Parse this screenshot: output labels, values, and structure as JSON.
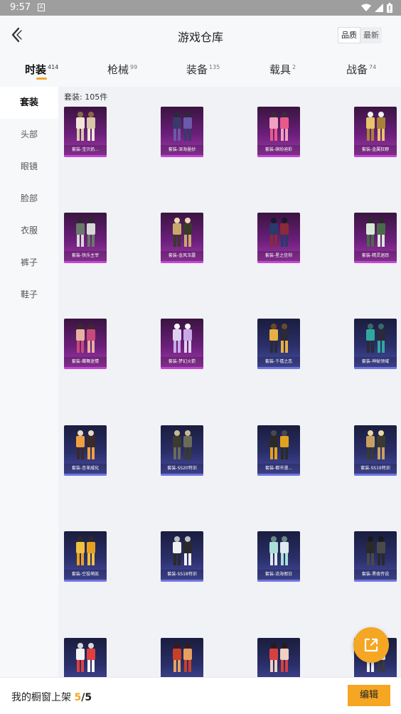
{
  "status_bar": {
    "time": "9:57",
    "notification_glyph": "A"
  },
  "header": {
    "title": "游戏仓库",
    "sort": [
      "品质",
      "最新"
    ],
    "sort_active": 0
  },
  "tabs": [
    {
      "label": "时装",
      "count": "414",
      "active": true
    },
    {
      "label": "枪械",
      "count": "99",
      "active": false
    },
    {
      "label": "装备",
      "count": "135",
      "active": false
    },
    {
      "label": "载具",
      "count": "2",
      "active": false
    },
    {
      "label": "战备",
      "count": "74",
      "active": false
    }
  ],
  "sidebar": [
    {
      "label": "套装",
      "active": true
    },
    {
      "label": "头部",
      "active": false
    },
    {
      "label": "眼镜",
      "active": false
    },
    {
      "label": "脸部",
      "active": false
    },
    {
      "label": "衣服",
      "active": false
    },
    {
      "label": "裤子",
      "active": false
    },
    {
      "label": "鞋子",
      "active": false
    }
  ],
  "content": {
    "count_label": "套装: 105件",
    "items": [
      {
        "label": "套装-宝贝奶...",
        "rarity": "purple"
      },
      {
        "label": "套装-深海曼妙",
        "rarity": "purple"
      },
      {
        "label": "套装-缤纷迪彩",
        "rarity": "purple"
      },
      {
        "label": "套装-金属狂野",
        "rarity": "purple"
      },
      {
        "label": "套装-快乐主宰",
        "rarity": "purple"
      },
      {
        "label": "套装-金风玉露",
        "rarity": "purple"
      },
      {
        "label": "套装-星之信仰",
        "rarity": "purple"
      },
      {
        "label": "套装-精灵迷踪",
        "rarity": "purple"
      },
      {
        "label": "套装-蝶舞迷情",
        "rarity": "purple"
      },
      {
        "label": "套装-梦幻火箭",
        "rarity": "purple"
      },
      {
        "label": "套装-千禧之恋",
        "rarity": "blue"
      },
      {
        "label": "套装-神秘领域",
        "rarity": "blue"
      },
      {
        "label": "套装-杏革威化",
        "rarity": "blue"
      },
      {
        "label": "套装-SS20特训",
        "rarity": "blue"
      },
      {
        "label": "套装-都市漫...",
        "rarity": "blue"
      },
      {
        "label": "套装-SS19特训",
        "rarity": "blue"
      },
      {
        "label": "套装-空投萌凯",
        "rarity": "blue"
      },
      {
        "label": "套装-SS18特训",
        "rarity": "blue"
      },
      {
        "label": "套装-流海假日",
        "rarity": "blue"
      },
      {
        "label": "套装-黑夜传说",
        "rarity": "blue"
      },
      {
        "label": "",
        "rarity": "blue"
      },
      {
        "label": "",
        "rarity": "blue"
      },
      {
        "label": "",
        "rarity": "blue"
      },
      {
        "label": "",
        "rarity": "blue"
      }
    ]
  },
  "bottom_bar": {
    "label": "我的橱窗上架",
    "current": "5",
    "separator": "/",
    "total": "5",
    "edit_label": "编辑"
  },
  "colors": {
    "accent": "#f5a623",
    "purple_card": "#6b1f7a",
    "blue_card": "#2b2f6a"
  },
  "icons": [
    "back-arrow-icon",
    "share-external-icon",
    "wifi-icon",
    "cellular-signal-icon",
    "battery-icon"
  ]
}
